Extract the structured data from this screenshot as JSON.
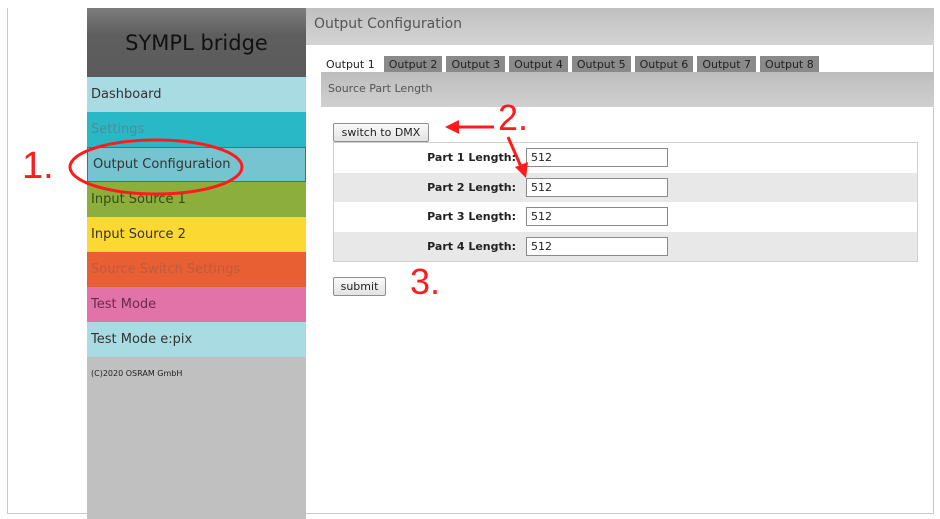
{
  "sidebar": {
    "brand": "SYMPL bridge",
    "items": [
      {
        "label": "Dashboard",
        "bg": "#a9dbe2",
        "color": "#333333"
      },
      {
        "label": "Settings",
        "bg": "#29b8c6",
        "color": "#4f8c98"
      },
      {
        "label": "Output Configuration",
        "bg": "#76c4d0",
        "color": "#333333"
      },
      {
        "label": "Input Source 1",
        "bg": "#8cae3d",
        "color": "#3a4a18"
      },
      {
        "label": "Input Source 2",
        "bg": "#fcd932",
        "color": "#333333"
      },
      {
        "label": "Source Switch Settings",
        "bg": "#e85f33",
        "color": "#c05a3c"
      },
      {
        "label": "Test Mode",
        "bg": "#e173a8",
        "color": "#6a2a4a"
      },
      {
        "label": "Test Mode e:pix",
        "bg": "#a9dbe2",
        "color": "#333333"
      }
    ],
    "copyright": "(C)2020 OSRAM GmbH"
  },
  "main": {
    "title": "Output Configuration",
    "tabs": [
      "Output 1",
      "Output 2",
      "Output 3",
      "Output 4",
      "Output 5",
      "Output 6",
      "Output 7",
      "Output 8"
    ],
    "active_tab": "Output 1",
    "section_title": "Source Part Length",
    "switch_button": "switch to DMX",
    "parts": [
      {
        "label": "Part 1 Length:",
        "value": "512"
      },
      {
        "label": "Part 2 Length:",
        "value": "512"
      },
      {
        "label": "Part 3 Length:",
        "value": "512"
      },
      {
        "label": "Part 4 Length:",
        "value": "512"
      }
    ],
    "submit_button": "submit"
  },
  "annotations": {
    "step1": "1.",
    "step2": "2.",
    "step3": "3.",
    "color": "#ff1b1b"
  }
}
